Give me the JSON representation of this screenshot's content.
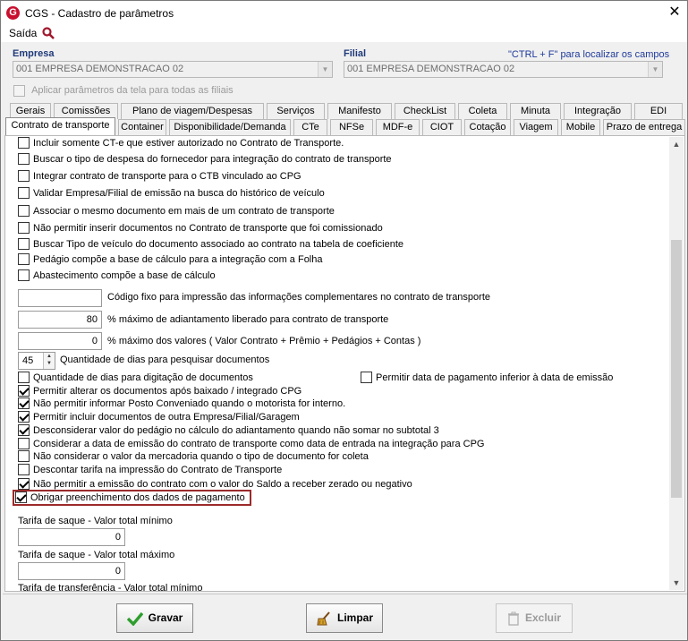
{
  "window": {
    "title": "CGS - Cadastro de parâmetros",
    "icon_glyph": "G",
    "close_glyph": "✕"
  },
  "menu": {
    "saida": "Saída",
    "search_icon": "search-icon"
  },
  "header": {
    "empresa_label": "Empresa",
    "filial_label": "Filial",
    "hint": "\"CTRL + F\" para localizar os campos",
    "empresa_value": "001 EMPRESA DEMONSTRACAO 02",
    "filial_value": "001 EMPRESA DEMONSTRACAO 02",
    "apply_all": "Aplicar parâmetros da tela para todas as filiais",
    "apply_all_checked": false
  },
  "tabs_row1": [
    "Gerais",
    "Comissões",
    "Plano de viagem/Despesas",
    "Serviços",
    "Manifesto",
    "CheckList",
    "Coleta",
    "Minuta",
    "Integração",
    "EDI"
  ],
  "tabs_row2": [
    "Contrato de transporte",
    "Container",
    "Disponibilidade/Demanda",
    "CTe",
    "NFSe",
    "MDF-e",
    "CIOT",
    "Cotação",
    "Viagem",
    "Mobile",
    "Prazo de entrega"
  ],
  "active_tab": "Contrato de transporte",
  "checkboxes_top": [
    {
      "label": "Incluir somente CT-e que estiver autorizado no Contrato de Transporte.",
      "checked": false
    },
    {
      "label": "Buscar o tipo de despesa do fornecedor para integração do contrato de transporte",
      "checked": false
    },
    {
      "label": "Integrar contrato de transporte para o CTB vinculado ao CPG",
      "checked": false
    },
    {
      "label": "Validar Empresa/Filial de emissão na busca do histórico de veículo",
      "checked": false
    },
    {
      "label": "Associar o mesmo documento em mais de um contrato de transporte",
      "checked": false
    },
    {
      "label": "Não permitir inserir documentos no Contrato de transporte que foi comissionado",
      "checked": false
    },
    {
      "label": "Buscar Tipo de veículo do documento associado ao contrato na tabela de coeficiente",
      "checked": false
    },
    {
      "label": "Pedágio compõe a base de cálculo para a integração com a Folha",
      "checked": false
    },
    {
      "label": "Abastecimento compõe a base de cálculo",
      "checked": false
    }
  ],
  "fields": {
    "codigo_fixo_label": "Código fixo para impressão das informações complementares no contrato de transporte",
    "codigo_fixo_value": "",
    "adiantamento_label": "% máximo de adiantamento liberado para contrato de transporte",
    "adiantamento_value": "80",
    "max_valores_label": "% máximo dos valores ( Valor Contrato + Prêmio + Pedágios + Contas )",
    "max_valores_value": "0",
    "dias_pesquisar_label": "Quantidade de dias para pesquisar documentos",
    "dias_pesquisar_value": "45"
  },
  "checkboxes_bottom": [
    {
      "label": "Quantidade de dias para digitação de documentos",
      "checked": false
    },
    {
      "label": "Permitir alterar os documentos após baixado / integrado CPG",
      "checked": true
    },
    {
      "label": "Não permitir informar Posto Conveniado quando o motorista for interno.",
      "checked": true
    },
    {
      "label": "Permitir incluir documentos de outra Empresa/Filial/Garagem",
      "checked": true
    },
    {
      "label": "Desconsiderar valor do pedágio no cálculo do adiantamento quando não somar no subtotal 3",
      "checked": true
    },
    {
      "label": "Considerar a data de emissão do contrato de transporte como data de entrada na integração para CPG",
      "checked": false
    },
    {
      "label": "Não considerar o valor da mercadoria quando o tipo de documento for coleta",
      "checked": false
    },
    {
      "label": "Descontar tarifa na impressão do Contrato de Transporte",
      "checked": false
    },
    {
      "label": "Não permitir a emissão do contrato com o valor do Saldo a receber zerado ou negativo",
      "checked": true
    },
    {
      "label": "Obrigar preenchimento dos dados de pagamento",
      "checked": true
    }
  ],
  "side_checkbox": {
    "label": "Permitir data de pagamento inferior à data de emissão",
    "checked": false
  },
  "tarifas": [
    {
      "label": "Tarifa de saque - Valor total mínimo",
      "value": "0"
    },
    {
      "label": "Tarifa de saque - Valor total máximo",
      "value": "0"
    },
    {
      "label": "Tarifa de transferência - Valor total mínimo",
      "value": ""
    }
  ],
  "buttons": {
    "gravar": "Gravar",
    "limpar": "Limpar",
    "excluir": "Excluir"
  },
  "colors": {
    "accent": "#1f3a7a",
    "highlight": "#9c2a2a",
    "app_icon": "#c8102e",
    "check_green": "#2e9e2e"
  }
}
